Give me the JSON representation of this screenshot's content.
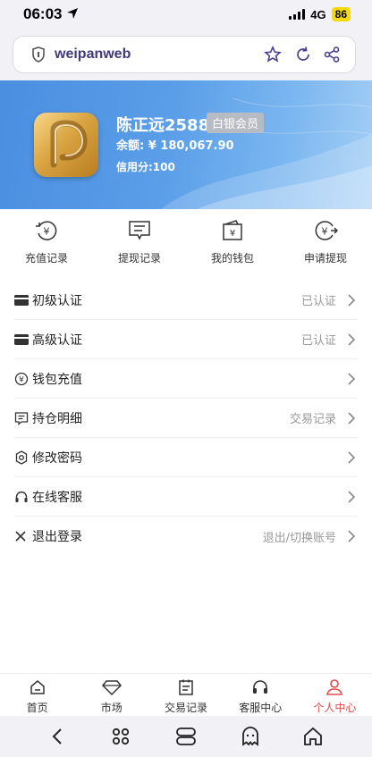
{
  "status_bar": {
    "time": "06:03",
    "network": "4G",
    "battery": "86"
  },
  "browser": {
    "url": "weipanweb"
  },
  "profile": {
    "name": "陈正远2588",
    "badge": "白银会员",
    "balance": "余额: ¥ 180,067.90",
    "credit": "信用分:100"
  },
  "quick_actions": [
    {
      "label": "充值记录",
      "icon": "recharge-record-icon"
    },
    {
      "label": "提现记录",
      "icon": "withdraw-record-icon"
    },
    {
      "label": "我的钱包",
      "icon": "wallet-icon"
    },
    {
      "label": "申请提现",
      "icon": "apply-withdraw-icon"
    }
  ],
  "menu": [
    {
      "label": "初级认证",
      "value": "已认证",
      "icon": "card-icon"
    },
    {
      "label": "高级认证",
      "value": "已认证",
      "icon": "card-icon"
    },
    {
      "label": "钱包充值",
      "value": "",
      "icon": "yen-circle-icon"
    },
    {
      "label": "持仓明细",
      "value": "交易记录",
      "icon": "message-icon"
    },
    {
      "label": "修改密码",
      "value": "",
      "icon": "gear-icon"
    },
    {
      "label": "在线客服",
      "value": "",
      "icon": "headset-icon"
    },
    {
      "label": "退出登录",
      "value": "退出/切换账号",
      "icon": "close-icon"
    }
  ],
  "tabs": [
    {
      "label": "首页",
      "icon": "home-icon"
    },
    {
      "label": "市场",
      "icon": "diamond-icon"
    },
    {
      "label": "交易记录",
      "icon": "list-icon"
    },
    {
      "label": "客服中心",
      "icon": "headset-icon"
    },
    {
      "label": "个人中心",
      "icon": "user-icon",
      "active": true
    }
  ],
  "colors": {
    "accent": "#e64a4a",
    "banner": "#4a8fe0",
    "badge": "#b7bcc4"
  }
}
